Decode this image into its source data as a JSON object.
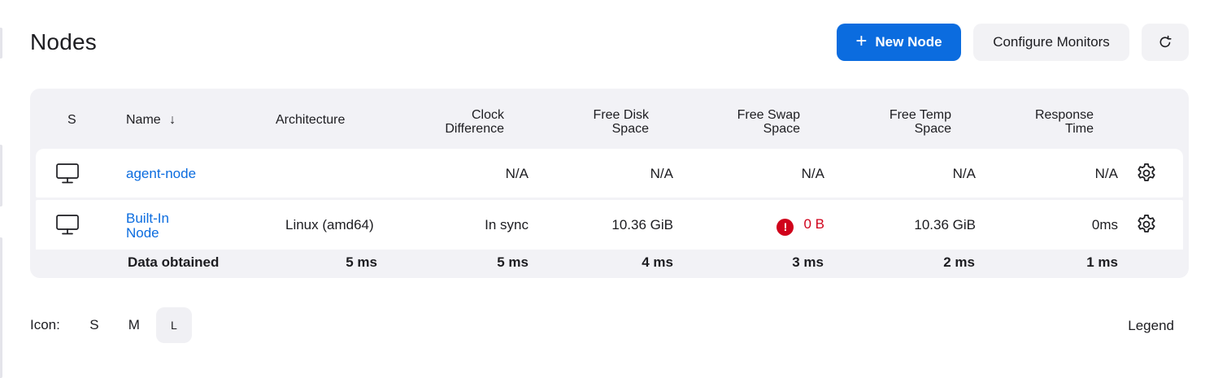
{
  "header": {
    "title": "Nodes",
    "new_node_label": "New Node",
    "configure_monitors_label": "Configure Monitors"
  },
  "table": {
    "headers": {
      "status": "S",
      "name": "Name",
      "sort_indicator": "↓",
      "architecture": "Architecture",
      "clock_line1": "Clock",
      "clock_line2": "Difference",
      "disk_line1": "Free Disk",
      "disk_line2": "Space",
      "swap_line1": "Free Swap",
      "swap_line2": "Space",
      "temp_line1": "Free Temp",
      "temp_line2": "Space",
      "response_line1": "Response",
      "response_line2": "Time"
    },
    "rows": [
      {
        "name": "agent-node",
        "architecture": "",
        "clock_difference": "N/A",
        "free_disk": "N/A",
        "free_swap": "N/A",
        "free_temp": "N/A",
        "response_time": "N/A"
      },
      {
        "name_line1": "Built-In",
        "name_line2": "Node",
        "architecture": "Linux (amd64)",
        "clock_difference": "In sync",
        "free_disk": "10.36 GiB",
        "free_swap_warning": "!",
        "free_swap": "0 B",
        "free_temp": "10.36 GiB",
        "response_time": "0ms"
      }
    ],
    "footer": {
      "label": "Data obtained",
      "architecture": "5 ms",
      "clock_difference": "5 ms",
      "free_disk": "4 ms",
      "free_swap": "3 ms",
      "free_temp": "2 ms",
      "response_time": "1 ms"
    }
  },
  "icon_size": {
    "label": "Icon:",
    "options": [
      "S",
      "M",
      "L"
    ],
    "selected": "L"
  },
  "legend_label": "Legend",
  "colors": {
    "accent": "#0b6cdf",
    "error": "#d0021b",
    "surface": "#f2f2f6"
  }
}
